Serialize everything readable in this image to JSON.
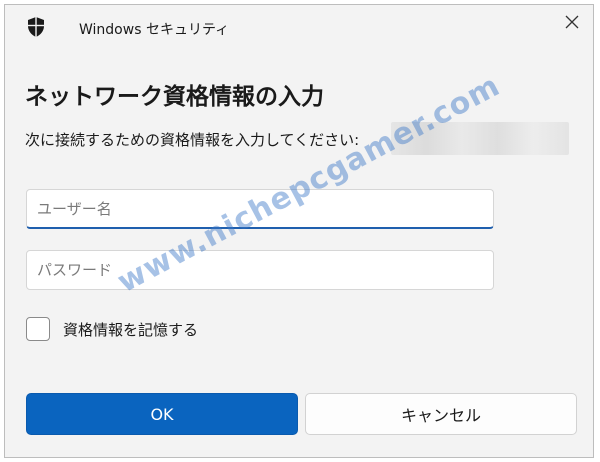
{
  "titlebar": {
    "app_title": "Windows セキュリティ",
    "icon": "shield-icon",
    "close_icon": "close-icon"
  },
  "dialog": {
    "heading": "ネットワーク資格情報の入力",
    "prompt": "次に接続するための資格情報を入力してください:"
  },
  "form": {
    "username_placeholder": "ユーザー名",
    "username_value": "",
    "password_placeholder": "パスワード",
    "password_value": "",
    "remember_label": "資格情報を記憶する",
    "remember_checked": false
  },
  "buttons": {
    "ok_label": "OK",
    "cancel_label": "キャンセル"
  },
  "watermark": "www.nichepcgamer.com",
  "colors": {
    "primary": "#0a64bf",
    "focus_underline": "#1f5fae",
    "dialog_background": "#f3f3f3"
  }
}
